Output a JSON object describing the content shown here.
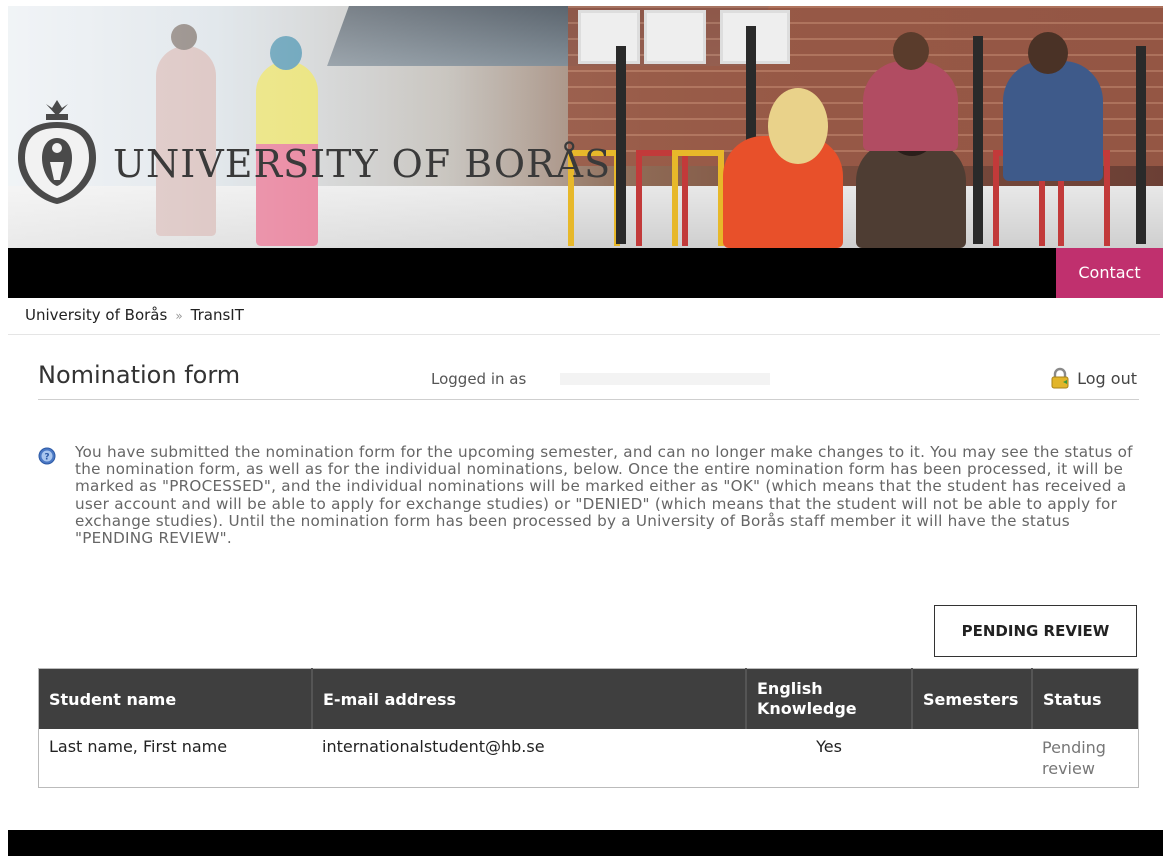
{
  "header": {
    "university_name": "UNIVERSITY OF BORÅS",
    "contact_label": "Contact"
  },
  "breadcrumb": {
    "home": "University of Borås",
    "separator": "»",
    "current": "TransIT"
  },
  "page": {
    "title": "Nomination form",
    "logged_in_label": "Logged in as",
    "logout_label": "Log out"
  },
  "info": {
    "text": "You have submitted the nomination form for the upcoming semester, and can no longer make changes to it. You may see the status of the nomination form, as well as for the individual nominations, below. Once the entire nomination form has been processed, it will be marked as \"PROCESSED\", and the individual nominations will be marked either as \"OK\" (which means that the student has received a user account and will be able to apply for exchange studies) or \"DENIED\" (which means that the student will not be able to apply for exchange studies). Until the nomination form has been processed by a University of Borås staff member it will have the status \"PENDING REVIEW\"."
  },
  "form_status": "PENDING REVIEW",
  "table": {
    "headers": [
      "Student name",
      "E-mail address",
      "English Knowledge",
      "Semesters",
      "Status"
    ],
    "rows": [
      {
        "student_name": "Last name, First name",
        "email": "internationalstudent@hb.se",
        "english": "Yes",
        "semesters": "",
        "status": "Pending review"
      }
    ]
  },
  "colors": {
    "accent": "#c0306e",
    "table_header": "#3f3f3f",
    "nav": "#000000"
  }
}
